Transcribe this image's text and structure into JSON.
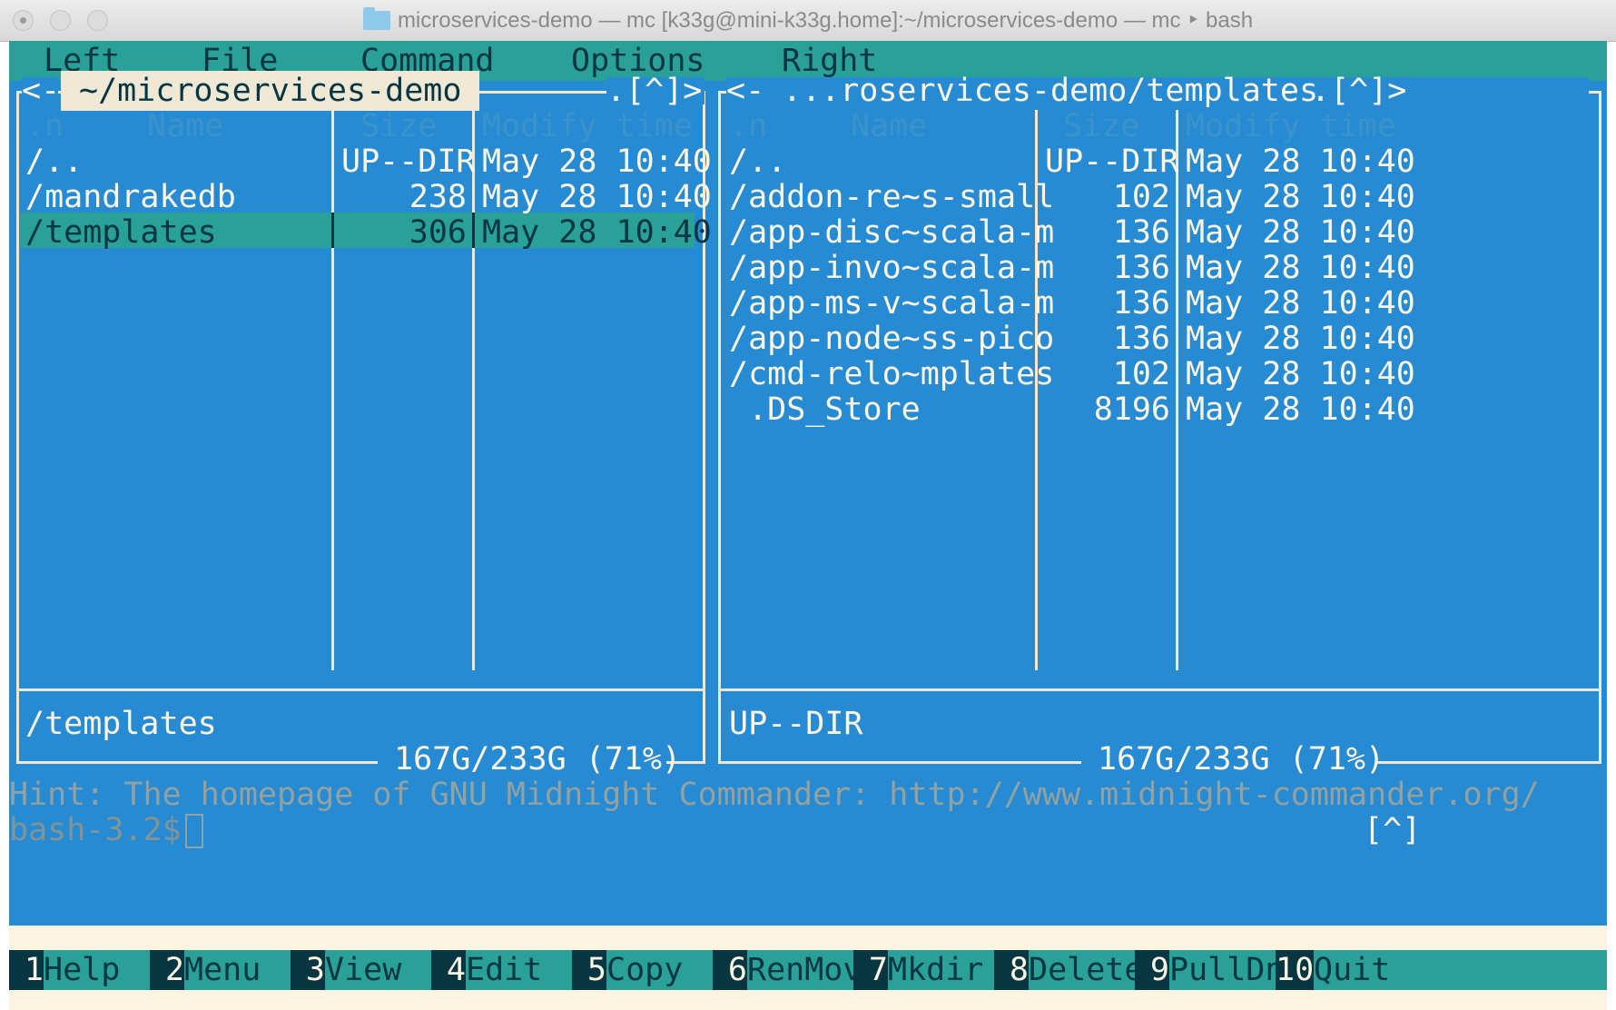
{
  "window": {
    "title": "microservices-demo — mc [k33g@mini-k33g.home]:~/microservices-demo — mc ‣ bash"
  },
  "menubar": [
    "Left",
    "File",
    "Command",
    "Options",
    "Right"
  ],
  "left_panel": {
    "path": "~/microservices-demo",
    "corner": ".[^]>",
    "columns": [
      ".n",
      "Name",
      "Size",
      "Modify time"
    ],
    "rows": [
      {
        "name": "/..",
        "size": "UP--DIR",
        "mtime": "May 28 10:40"
      },
      {
        "name": "/mandrakedb",
        "size": "238",
        "mtime": "May 28 10:40"
      },
      {
        "name": "/templates",
        "size": "306",
        "mtime": "May 28 10:40"
      }
    ],
    "selected_index": 2,
    "status": "/templates",
    "disk": "167G/233G (71%)"
  },
  "right_panel": {
    "path": "...roservices-demo/templates",
    "corner": ".[^]>",
    "columns": [
      ".n",
      "Name",
      "Size",
      "Modify time"
    ],
    "rows": [
      {
        "name": "/..",
        "size": "UP--DIR",
        "mtime": "May 28 10:40"
      },
      {
        "name": "/addon-re~s-small",
        "size": "102",
        "mtime": "May 28 10:40"
      },
      {
        "name": "/app-disc~scala-m",
        "size": "136",
        "mtime": "May 28 10:40"
      },
      {
        "name": "/app-invo~scala-m",
        "size": "136",
        "mtime": "May 28 10:40"
      },
      {
        "name": "/app-ms-v~scala-m",
        "size": "136",
        "mtime": "May 28 10:40"
      },
      {
        "name": "/app-node~ss-pico",
        "size": "136",
        "mtime": "May 28 10:40"
      },
      {
        "name": "/cmd-relo~mplates",
        "size": "102",
        "mtime": "May 28 10:40"
      },
      {
        "name": " .DS_Store",
        "size": "8196",
        "mtime": "May 28 10:40"
      }
    ],
    "status": "UP--DIR",
    "disk": "167G/233G (71%)"
  },
  "hint": "Hint: The homepage of GNU Midnight Commander: http://www.midnight-commander.org/",
  "prompt": "bash-3.2$",
  "history_button": "[^]",
  "function_keys": [
    {
      "num": "1",
      "label": "Help"
    },
    {
      "num": "2",
      "label": "Menu"
    },
    {
      "num": "3",
      "label": "View"
    },
    {
      "num": "4",
      "label": "Edit"
    },
    {
      "num": "5",
      "label": "Copy"
    },
    {
      "num": "6",
      "label": "RenMov"
    },
    {
      "num": "7",
      "label": "Mkdir"
    },
    {
      "num": "8",
      "label": "Delete"
    },
    {
      "num": "9",
      "label": "PullDn"
    },
    {
      "num": "10",
      "label": "Quit"
    }
  ],
  "colors": {
    "panel_bg": "#268bd2",
    "menubar_bg": "#2aa198",
    "selection_bg": "#2aa198",
    "terminal_bg": "#fdf5e2",
    "text_light": "#fdf6e3",
    "text_dark": "#073642"
  },
  "icons": {
    "title_folder": "folder-icon"
  }
}
